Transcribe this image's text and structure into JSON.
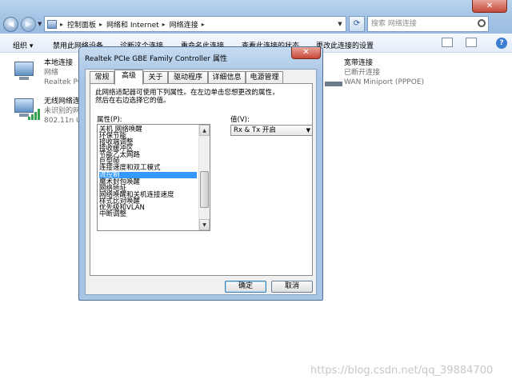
{
  "explorer": {
    "breadcrumbs": [
      "控制面板",
      "网络和 Internet",
      "网络连接"
    ],
    "search_placeholder": "搜索 网络连接",
    "commands": [
      {
        "label": "组织 ▾"
      },
      {
        "label": "禁用此网络设备"
      },
      {
        "label": "诊断这个连接"
      },
      {
        "label": "重命名此连接"
      },
      {
        "label": "查看此连接的状态"
      },
      {
        "label": "更改此连接的设置"
      }
    ],
    "connections": [
      {
        "name": "本地连接",
        "status": "网络",
        "device": "Realtek PC"
      },
      {
        "name": "无线网络连",
        "status": "未识别的网",
        "device": "802.11n U"
      },
      {
        "name": "宽带连接",
        "status": "已断开连接",
        "device": "WAN Miniport (PPPOE)"
      }
    ],
    "watermark": "https://blog.csdn.net/qq_39884700"
  },
  "dialog": {
    "title": "Realtek PCIe GBE Family Controller 属性",
    "close_label": "✕",
    "tabs": [
      {
        "label": "常规",
        "active": false
      },
      {
        "label": "高级",
        "active": true
      },
      {
        "label": "关于",
        "active": false
      },
      {
        "label": "驱动程序",
        "active": false
      },
      {
        "label": "详细信息",
        "active": false
      },
      {
        "label": "电源管理",
        "active": false
      }
    ],
    "description": "此网络适配器可使用下列属性。在左边单击您想更改的属性，\n然后在右边选择它的值。",
    "property_label": "属性(P):",
    "value_label": "值(V):",
    "properties": [
      "关机 网络唤醒",
      "环保节能",
      "接收端调整",
      "接收缓冲区",
      "节能乙太网路",
      "巨型帧",
      "连接速度和双工模式",
      "流控制",
      "魔术封包唤醒",
      "网络地址",
      "网络唤醒和关机连接速度",
      "样式比对唤醒",
      "优先级和VLAN",
      "中断调整"
    ],
    "selected_property": "流控制",
    "value": "Rx & Tx 开启",
    "ok_label": "确定",
    "cancel_label": "取消"
  }
}
